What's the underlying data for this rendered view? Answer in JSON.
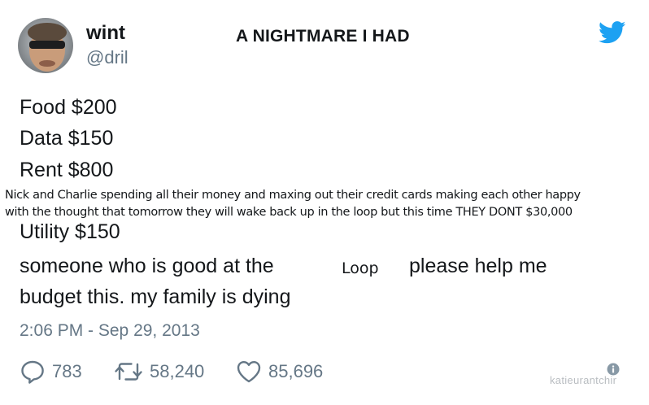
{
  "tweet": {
    "author": {
      "display_name": "wint",
      "handle": "@dril"
    },
    "meme_caption": "A NIGHTMARE I HAD",
    "lines": [
      "Food $200",
      "Data $150",
      "Rent $800"
    ],
    "overlay_lines": [
      "Nick and Charlie spending all their money and maxing out their credit cards making each other happy",
      "with the thought that tomorrow they will wake back up in the loop but this time THEY DONT  $30,000"
    ],
    "utility_line": "Utility $150",
    "line_before_loop": "someone who is good at the",
    "loop_word": "Loop",
    "line_after_loop": "please help me",
    "last_line": "budget this. my family is dying",
    "timestamp": "2:06 PM - Sep 29, 2013",
    "stats": {
      "replies": "783",
      "retweets": "58,240",
      "likes": "85,696"
    },
    "watermark": "katieurantchir"
  },
  "colors": {
    "text": "#14171a",
    "secondary": "#657786",
    "twitter_blue": "#1da1f2"
  },
  "icons": [
    "twitter-bird-icon",
    "reply-icon",
    "retweet-icon",
    "like-icon",
    "info-icon"
  ]
}
